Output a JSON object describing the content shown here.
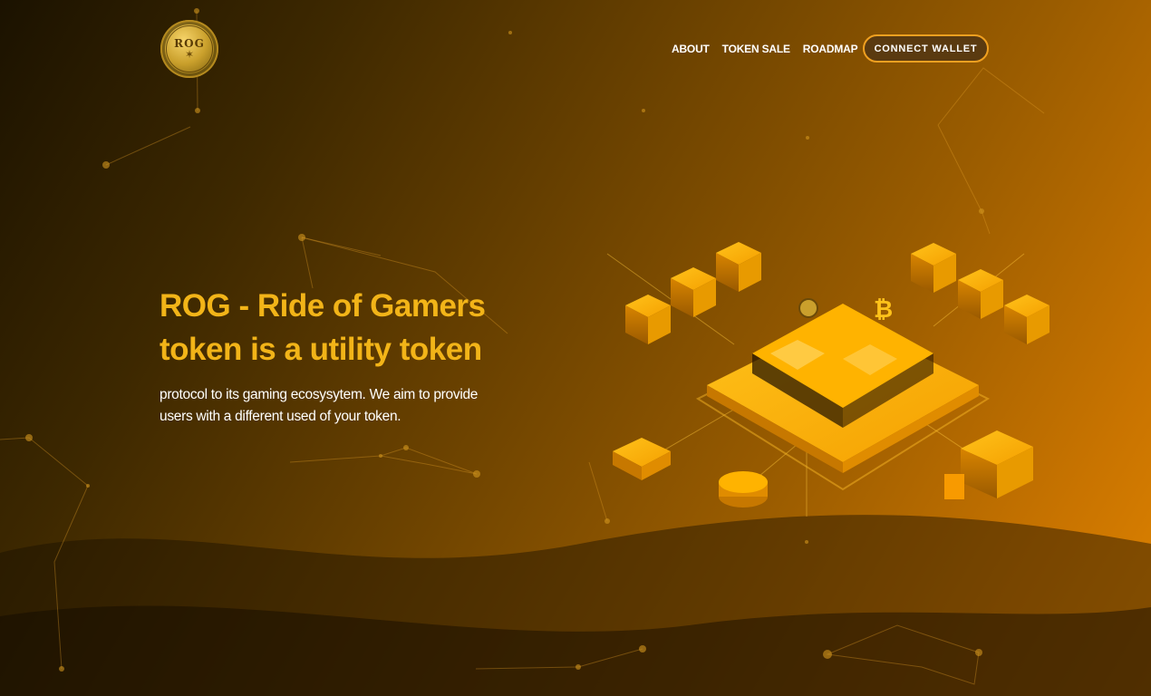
{
  "brand": {
    "logo_text": "ROG",
    "logo_icon": "eagle-emblem-icon"
  },
  "nav": {
    "items": [
      {
        "label": "ABOUT"
      },
      {
        "label": "TOKEN SALE"
      },
      {
        "label": "ROADMAP"
      }
    ],
    "connect_label": "CONNECT WALLET"
  },
  "hero": {
    "title_line1": "ROG - Ride of Gamers",
    "title_line2": "token is a utility token",
    "desc_line1": "protocol to its gaming ecosysytem. We aim to provide",
    "desc_line2": "users with a different used of your token."
  },
  "illustration": {
    "coin_symbol": "₿",
    "icon": "isometric-blockchain-icon"
  },
  "colors": {
    "accent": "#f2b418",
    "button_border": "#f0a020",
    "background_dark": "#1b1200",
    "background_light": "#e08400"
  }
}
